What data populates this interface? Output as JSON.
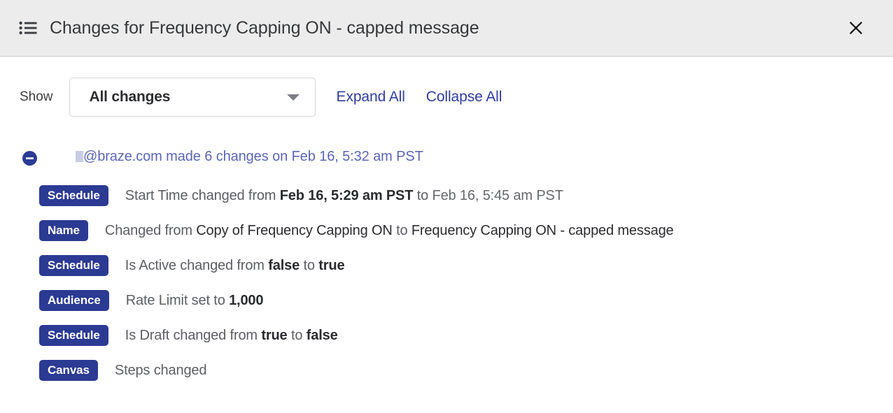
{
  "header": {
    "title": "Changes for Frequency Capping ON - capped message",
    "list_icon": "list-icon",
    "close_icon": "close-icon"
  },
  "toolbar": {
    "show_label": "Show",
    "filter_value": "All changes",
    "filter_options": [
      "All changes"
    ],
    "expand_all_label": "Expand All",
    "collapse_all_label": "Collapse All",
    "caret_icon": "chevron-down-icon"
  },
  "changes": {
    "group": {
      "toggle_icon": "minus-circle-icon",
      "author_redacted": "",
      "title": "@braze.com made 6 changes on Feb 16, 5:32 am PST",
      "rows": [
        {
          "badge": "Schedule",
          "prefix": "Start Time changed from ",
          "from_value": "Feb 16, 5:29 am PST",
          "from_style": "bold",
          "middle": " to ",
          "to_value": "Feb 16, 5:45 am PST",
          "to_style": "muted",
          "suffix": ""
        },
        {
          "badge": "Name",
          "prefix": "Changed from ",
          "from_value": "Copy of Frequency Capping ON",
          "from_style": "plain",
          "middle": " to ",
          "to_value": "Frequency Capping ON - capped message",
          "to_style": "plain",
          "suffix": ""
        },
        {
          "badge": "Schedule",
          "prefix": "Is Active changed from ",
          "from_value": "false",
          "from_style": "bold",
          "middle": " to ",
          "to_value": "true",
          "to_style": "bold",
          "suffix": ""
        },
        {
          "badge": "Audience",
          "prefix": "Rate Limit set to ",
          "from_value": "1,000",
          "from_style": "bold",
          "middle": "",
          "to_value": "",
          "to_style": "bold",
          "suffix": ""
        },
        {
          "badge": "Schedule",
          "prefix": "Is Draft changed from ",
          "from_value": "true",
          "from_style": "bold",
          "middle": " to ",
          "to_value": "false",
          "to_style": "bold",
          "suffix": ""
        },
        {
          "badge": "Canvas",
          "prefix": "Steps changed",
          "from_value": "",
          "from_style": "bold",
          "middle": "",
          "to_value": "",
          "to_style": "bold",
          "suffix": ""
        }
      ]
    }
  },
  "colors": {
    "badge_bg": "#2b3a93",
    "link": "#2f3d9e",
    "group_title": "#5b66b5",
    "header_bg": "#ececec"
  }
}
